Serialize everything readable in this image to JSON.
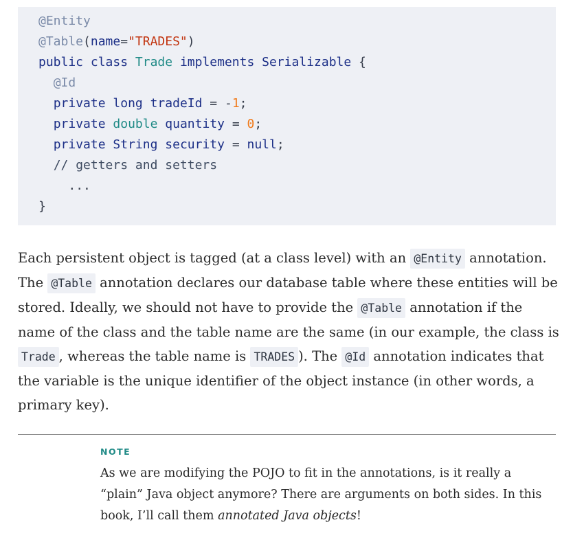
{
  "code": {
    "l1": {
      "ann": "@Entity"
    },
    "l2": {
      "ann": "@Table",
      "open": "(",
      "attr": "name",
      "eq": "=",
      "str": "\"TRADES\"",
      "close": ")"
    },
    "l3": {
      "public": "public",
      "class": "class",
      "name": "Trade",
      "implements": "implements",
      "iface": "Serializable",
      "brace": "{"
    },
    "l4": {
      "ann": "@Id"
    },
    "l5": {
      "private": "private",
      "type": "long",
      "var": "tradeId",
      "eq": "=",
      "minus": "-",
      "num": "1",
      "semi": ";"
    },
    "l6": {
      "private": "private",
      "type": "double",
      "var": "quantity",
      "eq": "=",
      "num": "0",
      "semi": ";"
    },
    "l7": {
      "private": "private",
      "type": "String",
      "var": "security",
      "eq": "=",
      "val": "null",
      "semi": ";"
    },
    "l8": {
      "comment": "// getters and setters"
    },
    "l9": {
      "ellipsis": "..."
    },
    "l10": {
      "brace": "}"
    }
  },
  "para": {
    "t1": "Each persistent object is tagged (at a class level) with an",
    "c1": "@Entity",
    "t2": "annotation. The",
    "c2": "@Table",
    "t3": "annotation declares our database table where these entities will be stored. Ideally, we should not have to provide the",
    "c3": "@Table",
    "t4": "annotation if the name of the class and the table name are the same (in our example, the class is",
    "c4": "Trade",
    "t5": ", whereas the table name is",
    "c5": "TRADES",
    "t6": "). The",
    "c6": "@Id",
    "t7": "annotation indicates that the variable is the unique identifier of the object instance (in other words, a primary key)."
  },
  "note": {
    "label": "NOTE",
    "t1": "As we are modifying the POJO to fit in the annotations, is it really a “plain” Java object anymore? There are arguments on both sides. In this book, I’ll call them",
    "em": "annotated Java objects",
    "t2": "!"
  }
}
